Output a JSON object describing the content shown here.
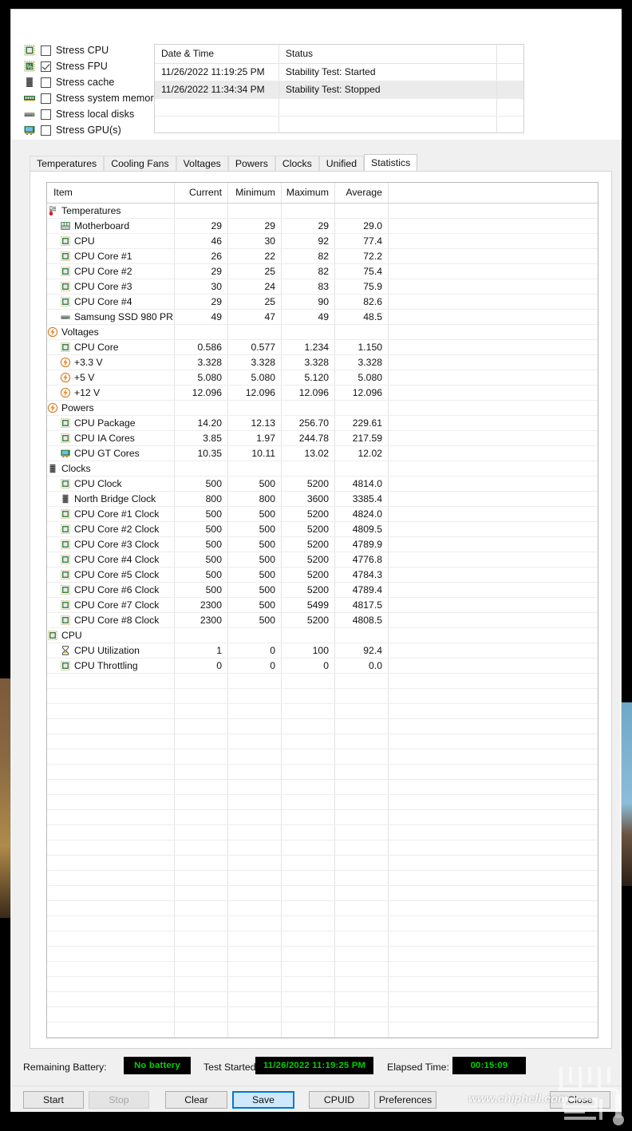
{
  "stress_options": [
    {
      "icon": "cpu-chip-icon",
      "label": "Stress CPU",
      "checked": false
    },
    {
      "icon": "fpu-percent-icon",
      "label": "Stress FPU",
      "checked": true
    },
    {
      "icon": "cache-chip-icon",
      "label": "Stress cache",
      "checked": false
    },
    {
      "icon": "memory-module-icon",
      "label": "Stress system memory",
      "checked": false
    },
    {
      "icon": "hard-disk-icon",
      "label": "Stress local disks",
      "checked": false
    },
    {
      "icon": "gpu-card-icon",
      "label": "Stress GPU(s)",
      "checked": false
    }
  ],
  "log": {
    "headers": [
      "Date & Time",
      "Status",
      ""
    ],
    "rows": [
      {
        "datetime": "11/26/2022 11:19:25 PM",
        "status": "Stability Test: Started"
      },
      {
        "datetime": "11/26/2022 11:34:34 PM",
        "status": "Stability Test: Stopped"
      }
    ],
    "empty_rows": 3
  },
  "tabs": [
    {
      "label": "Temperatures",
      "active": false
    },
    {
      "label": "Cooling Fans",
      "active": false
    },
    {
      "label": "Voltages",
      "active": false
    },
    {
      "label": "Powers",
      "active": false
    },
    {
      "label": "Clocks",
      "active": false
    },
    {
      "label": "Unified",
      "active": false
    },
    {
      "label": "Statistics",
      "active": true
    }
  ],
  "statistics": {
    "headers": [
      "Item",
      "Current",
      "Minimum",
      "Maximum",
      "Average"
    ],
    "rows": [
      {
        "level": 0,
        "icon": "thermometer-icon",
        "item": "Temperatures",
        "current": "",
        "minimum": "",
        "maximum": "",
        "average": ""
      },
      {
        "level": 1,
        "icon": "motherboard-icon",
        "item": "Motherboard",
        "current": "29",
        "minimum": "29",
        "maximum": "29",
        "average": "29.0"
      },
      {
        "level": 1,
        "icon": "cpu-chip-icon",
        "item": "CPU",
        "current": "46",
        "minimum": "30",
        "maximum": "92",
        "average": "77.4"
      },
      {
        "level": 1,
        "icon": "cpu-chip-icon",
        "item": "CPU Core #1",
        "current": "26",
        "minimum": "22",
        "maximum": "82",
        "average": "72.2"
      },
      {
        "level": 1,
        "icon": "cpu-chip-icon",
        "item": "CPU Core #2",
        "current": "29",
        "minimum": "25",
        "maximum": "82",
        "average": "75.4"
      },
      {
        "level": 1,
        "icon": "cpu-chip-icon",
        "item": "CPU Core #3",
        "current": "30",
        "minimum": "24",
        "maximum": "83",
        "average": "75.9"
      },
      {
        "level": 1,
        "icon": "cpu-chip-icon",
        "item": "CPU Core #4",
        "current": "29",
        "minimum": "25",
        "maximum": "90",
        "average": "82.6"
      },
      {
        "level": 1,
        "icon": "hard-disk-icon",
        "item": "Samsung SSD 980 PR...",
        "current": "49",
        "minimum": "47",
        "maximum": "49",
        "average": "48.5"
      },
      {
        "level": 0,
        "icon": "voltage-bolt-icon",
        "item": "Voltages",
        "current": "",
        "minimum": "",
        "maximum": "",
        "average": ""
      },
      {
        "level": 1,
        "icon": "cpu-chip-icon",
        "item": "CPU Core",
        "current": "0.586",
        "minimum": "0.577",
        "maximum": "1.234",
        "average": "1.150"
      },
      {
        "level": 1,
        "icon": "voltage-bolt-icon",
        "item": "+3.3 V",
        "current": "3.328",
        "minimum": "3.328",
        "maximum": "3.328",
        "average": "3.328"
      },
      {
        "level": 1,
        "icon": "voltage-bolt-icon",
        "item": "+5 V",
        "current": "5.080",
        "minimum": "5.080",
        "maximum": "5.120",
        "average": "5.080"
      },
      {
        "level": 1,
        "icon": "voltage-bolt-icon",
        "item": "+12 V",
        "current": "12.096",
        "minimum": "12.096",
        "maximum": "12.096",
        "average": "12.096"
      },
      {
        "level": 0,
        "icon": "voltage-bolt-icon",
        "item": "Powers",
        "current": "",
        "minimum": "",
        "maximum": "",
        "average": ""
      },
      {
        "level": 1,
        "icon": "cpu-chip-icon",
        "item": "CPU Package",
        "current": "14.20",
        "minimum": "12.13",
        "maximum": "256.70",
        "average": "229.61"
      },
      {
        "level": 1,
        "icon": "cpu-chip-icon",
        "item": "CPU IA Cores",
        "current": "3.85",
        "minimum": "1.97",
        "maximum": "244.78",
        "average": "217.59"
      },
      {
        "level": 1,
        "icon": "gpu-card-icon",
        "item": "CPU GT Cores",
        "current": "10.35",
        "minimum": "10.11",
        "maximum": "13.02",
        "average": "12.02"
      },
      {
        "level": 0,
        "icon": "cache-chip-icon",
        "item": "Clocks",
        "current": "",
        "minimum": "",
        "maximum": "",
        "average": ""
      },
      {
        "level": 1,
        "icon": "cpu-chip-icon",
        "item": "CPU Clock",
        "current": "500",
        "minimum": "500",
        "maximum": "5200",
        "average": "4814.0"
      },
      {
        "level": 1,
        "icon": "cache-chip-icon",
        "item": "North Bridge Clock",
        "current": "800",
        "minimum": "800",
        "maximum": "3600",
        "average": "3385.4"
      },
      {
        "level": 1,
        "icon": "cpu-chip-icon",
        "item": "CPU Core #1 Clock",
        "current": "500",
        "minimum": "500",
        "maximum": "5200",
        "average": "4824.0"
      },
      {
        "level": 1,
        "icon": "cpu-chip-icon",
        "item": "CPU Core #2 Clock",
        "current": "500",
        "minimum": "500",
        "maximum": "5200",
        "average": "4809.5"
      },
      {
        "level": 1,
        "icon": "cpu-chip-icon",
        "item": "CPU Core #3 Clock",
        "current": "500",
        "minimum": "500",
        "maximum": "5200",
        "average": "4789.9"
      },
      {
        "level": 1,
        "icon": "cpu-chip-icon",
        "item": "CPU Core #4 Clock",
        "current": "500",
        "minimum": "500",
        "maximum": "5200",
        "average": "4776.8"
      },
      {
        "level": 1,
        "icon": "cpu-chip-icon",
        "item": "CPU Core #5 Clock",
        "current": "500",
        "minimum": "500",
        "maximum": "5200",
        "average": "4784.3"
      },
      {
        "level": 1,
        "icon": "cpu-chip-icon",
        "item": "CPU Core #6 Clock",
        "current": "500",
        "minimum": "500",
        "maximum": "5200",
        "average": "4789.4"
      },
      {
        "level": 1,
        "icon": "cpu-chip-icon",
        "item": "CPU Core #7 Clock",
        "current": "2300",
        "minimum": "500",
        "maximum": "5499",
        "average": "4817.5"
      },
      {
        "level": 1,
        "icon": "cpu-chip-icon",
        "item": "CPU Core #8 Clock",
        "current": "2300",
        "minimum": "500",
        "maximum": "5200",
        "average": "4808.5"
      },
      {
        "level": 0,
        "icon": "cpu-chip-icon",
        "item": "CPU",
        "current": "",
        "minimum": "",
        "maximum": "",
        "average": ""
      },
      {
        "level": 1,
        "icon": "hourglass-icon",
        "item": "CPU Utilization",
        "current": "1",
        "minimum": "0",
        "maximum": "100",
        "average": "92.4"
      },
      {
        "level": 1,
        "icon": "cpu-chip-icon",
        "item": "CPU Throttling",
        "current": "0",
        "minimum": "0",
        "maximum": "0",
        "average": "0.0"
      }
    ],
    "empty_row_count": 26
  },
  "status_bar": {
    "battery_label": "Remaining Battery:",
    "battery_value": "No battery",
    "test_started_label": "Test Started:",
    "test_started_value": "11/26/2022 11:19:25 PM",
    "elapsed_label": "Elapsed Time:",
    "elapsed_value": "00:15:09",
    "lcd_text_color": "#00d000",
    "lcd_bg_color": "#000000"
  },
  "buttons": [
    {
      "name": "start",
      "label": "Start",
      "state": "normal"
    },
    {
      "name": "stop",
      "label": "Stop",
      "state": "disabled"
    },
    {
      "name": "clear",
      "label": "Clear",
      "state": "normal"
    },
    {
      "name": "save",
      "label": "Save",
      "state": "primary"
    },
    {
      "name": "cpuid",
      "label": "CPUID",
      "state": "normal"
    },
    {
      "name": "preferences",
      "label": "Preferences",
      "state": "normal"
    },
    {
      "name": "close",
      "label": "Close",
      "state": "normal"
    }
  ],
  "watermark": {
    "url_text": "www.chiphell.com",
    "logo_name": "chiphell-logo"
  }
}
